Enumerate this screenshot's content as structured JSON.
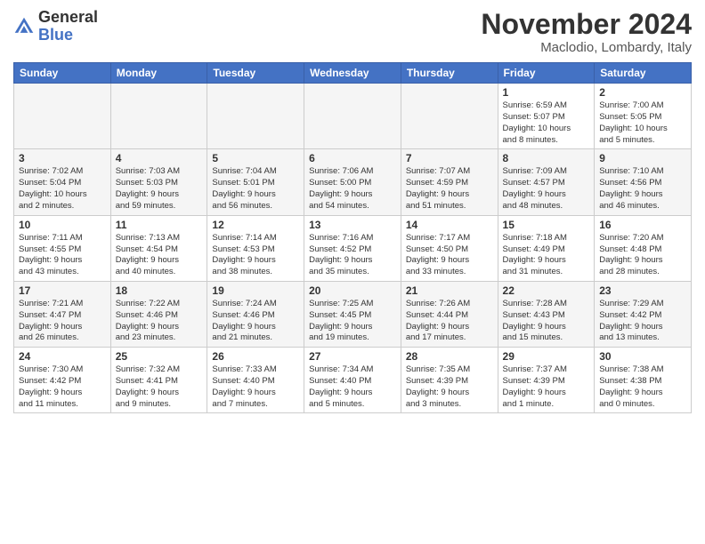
{
  "header": {
    "logo_general": "General",
    "logo_blue": "Blue",
    "title": "November 2024",
    "location": "Maclodio, Lombardy, Italy"
  },
  "columns": [
    "Sunday",
    "Monday",
    "Tuesday",
    "Wednesday",
    "Thursday",
    "Friday",
    "Saturday"
  ],
  "weeks": [
    [
      {
        "day": "",
        "info": ""
      },
      {
        "day": "",
        "info": ""
      },
      {
        "day": "",
        "info": ""
      },
      {
        "day": "",
        "info": ""
      },
      {
        "day": "",
        "info": ""
      },
      {
        "day": "1",
        "info": "Sunrise: 6:59 AM\nSunset: 5:07 PM\nDaylight: 10 hours\nand 8 minutes."
      },
      {
        "day": "2",
        "info": "Sunrise: 7:00 AM\nSunset: 5:05 PM\nDaylight: 10 hours\nand 5 minutes."
      }
    ],
    [
      {
        "day": "3",
        "info": "Sunrise: 7:02 AM\nSunset: 5:04 PM\nDaylight: 10 hours\nand 2 minutes."
      },
      {
        "day": "4",
        "info": "Sunrise: 7:03 AM\nSunset: 5:03 PM\nDaylight: 9 hours\nand 59 minutes."
      },
      {
        "day": "5",
        "info": "Sunrise: 7:04 AM\nSunset: 5:01 PM\nDaylight: 9 hours\nand 56 minutes."
      },
      {
        "day": "6",
        "info": "Sunrise: 7:06 AM\nSunset: 5:00 PM\nDaylight: 9 hours\nand 54 minutes."
      },
      {
        "day": "7",
        "info": "Sunrise: 7:07 AM\nSunset: 4:59 PM\nDaylight: 9 hours\nand 51 minutes."
      },
      {
        "day": "8",
        "info": "Sunrise: 7:09 AM\nSunset: 4:57 PM\nDaylight: 9 hours\nand 48 minutes."
      },
      {
        "day": "9",
        "info": "Sunrise: 7:10 AM\nSunset: 4:56 PM\nDaylight: 9 hours\nand 46 minutes."
      }
    ],
    [
      {
        "day": "10",
        "info": "Sunrise: 7:11 AM\nSunset: 4:55 PM\nDaylight: 9 hours\nand 43 minutes."
      },
      {
        "day": "11",
        "info": "Sunrise: 7:13 AM\nSunset: 4:54 PM\nDaylight: 9 hours\nand 40 minutes."
      },
      {
        "day": "12",
        "info": "Sunrise: 7:14 AM\nSunset: 4:53 PM\nDaylight: 9 hours\nand 38 minutes."
      },
      {
        "day": "13",
        "info": "Sunrise: 7:16 AM\nSunset: 4:52 PM\nDaylight: 9 hours\nand 35 minutes."
      },
      {
        "day": "14",
        "info": "Sunrise: 7:17 AM\nSunset: 4:50 PM\nDaylight: 9 hours\nand 33 minutes."
      },
      {
        "day": "15",
        "info": "Sunrise: 7:18 AM\nSunset: 4:49 PM\nDaylight: 9 hours\nand 31 minutes."
      },
      {
        "day": "16",
        "info": "Sunrise: 7:20 AM\nSunset: 4:48 PM\nDaylight: 9 hours\nand 28 minutes."
      }
    ],
    [
      {
        "day": "17",
        "info": "Sunrise: 7:21 AM\nSunset: 4:47 PM\nDaylight: 9 hours\nand 26 minutes."
      },
      {
        "day": "18",
        "info": "Sunrise: 7:22 AM\nSunset: 4:46 PM\nDaylight: 9 hours\nand 23 minutes."
      },
      {
        "day": "19",
        "info": "Sunrise: 7:24 AM\nSunset: 4:46 PM\nDaylight: 9 hours\nand 21 minutes."
      },
      {
        "day": "20",
        "info": "Sunrise: 7:25 AM\nSunset: 4:45 PM\nDaylight: 9 hours\nand 19 minutes."
      },
      {
        "day": "21",
        "info": "Sunrise: 7:26 AM\nSunset: 4:44 PM\nDaylight: 9 hours\nand 17 minutes."
      },
      {
        "day": "22",
        "info": "Sunrise: 7:28 AM\nSunset: 4:43 PM\nDaylight: 9 hours\nand 15 minutes."
      },
      {
        "day": "23",
        "info": "Sunrise: 7:29 AM\nSunset: 4:42 PM\nDaylight: 9 hours\nand 13 minutes."
      }
    ],
    [
      {
        "day": "24",
        "info": "Sunrise: 7:30 AM\nSunset: 4:42 PM\nDaylight: 9 hours\nand 11 minutes."
      },
      {
        "day": "25",
        "info": "Sunrise: 7:32 AM\nSunset: 4:41 PM\nDaylight: 9 hours\nand 9 minutes."
      },
      {
        "day": "26",
        "info": "Sunrise: 7:33 AM\nSunset: 4:40 PM\nDaylight: 9 hours\nand 7 minutes."
      },
      {
        "day": "27",
        "info": "Sunrise: 7:34 AM\nSunset: 4:40 PM\nDaylight: 9 hours\nand 5 minutes."
      },
      {
        "day": "28",
        "info": "Sunrise: 7:35 AM\nSunset: 4:39 PM\nDaylight: 9 hours\nand 3 minutes."
      },
      {
        "day": "29",
        "info": "Sunrise: 7:37 AM\nSunset: 4:39 PM\nDaylight: 9 hours\nand 1 minute."
      },
      {
        "day": "30",
        "info": "Sunrise: 7:38 AM\nSunset: 4:38 PM\nDaylight: 9 hours\nand 0 minutes."
      }
    ]
  ]
}
